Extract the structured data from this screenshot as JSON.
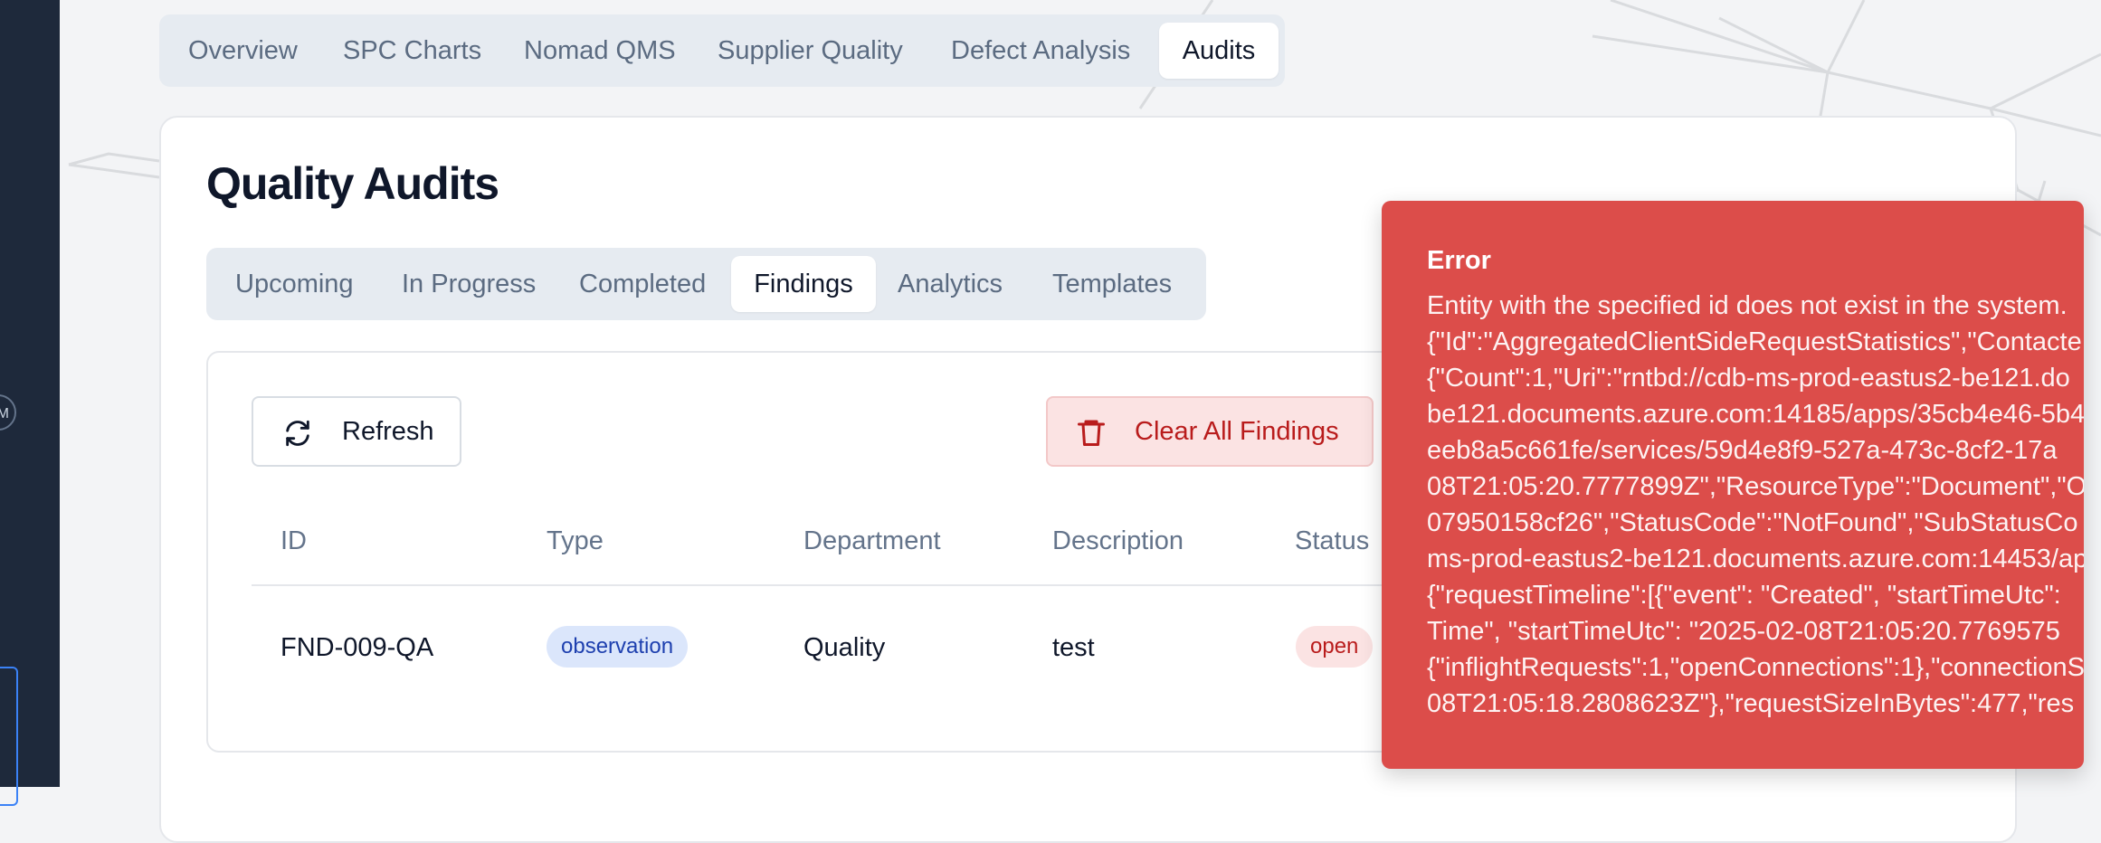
{
  "main_tabs": [
    "Overview",
    "SPC Charts",
    "Nomad QMS",
    "Supplier Quality",
    "Defect Analysis",
    "Audits"
  ],
  "main_active_tab": "Audits",
  "page_title": "Quality Audits",
  "sub_tabs": [
    "Upcoming",
    "In Progress",
    "Completed",
    "Findings",
    "Analytics",
    "Templates"
  ],
  "sub_active_tab": "Findings",
  "toolbar": {
    "refresh_label": "Refresh",
    "clear_label": "Clear All Findings"
  },
  "table": {
    "columns": [
      "ID",
      "Type",
      "Department",
      "Description",
      "Status"
    ],
    "rows": [
      {
        "id": "FND-009-QA",
        "type": "observation",
        "department": "Quality",
        "description": "test",
        "status": "open"
      }
    ]
  },
  "left_rail": {
    "avatar_glyph": "M"
  },
  "error_toast": {
    "title": "Error",
    "lines": [
      "Entity with the specified id does not exist in the system.",
      "{\"Id\":\"AggregatedClientSideRequestStatistics\",\"Contacte",
      "{\"Count\":1,\"Uri\":\"rntbd://cdb-ms-prod-eastus2-be121.do",
      "be121.documents.azure.com:14185/apps/35cb4e46-5b4",
      "eeb8a5c661fe/services/59d4e8f9-527a-473c-8cf2-17a",
      "08T21:05:20.7777899Z\",\"ResourceType\":\"Document\",\"O",
      "07950158cf26\",\"StatusCode\":\"NotFound\",\"SubStatusCo",
      "ms-prod-eastus2-be121.documents.azure.com:14453/ap",
      "{\"requestTimeline\":[{\"event\": \"Created\", \"startTimeUtc\":",
      "Time\", \"startTimeUtc\": \"2025-02-08T21:05:20.7769575",
      "{\"inflightRequests\":1,\"openConnections\":1},\"connectionS",
      "08T21:05:18.2808623Z\"},\"requestSizeInBytes\":477,\"res"
    ]
  },
  "colors": {
    "toast_bg": "#dc4d4a",
    "danger": "#b91c1c",
    "badge_info_bg": "#dbe6fb",
    "badge_info_text": "#1e40af",
    "tab_bar_bg": "#e6ebf1",
    "sidebar_bg": "#1e293b"
  },
  "icons": {
    "refresh": "refresh-icon",
    "trash": "trash-icon"
  }
}
